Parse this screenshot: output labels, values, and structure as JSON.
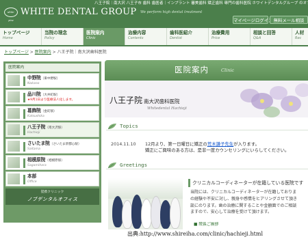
{
  "header": {
    "topline": "八王子院｜南大沢 八王子市 歯科 歯医者｜インプラント 審美歯科 矯正歯科 専門の歯科医院 ホワイトデンタルグループ のオフィシャ",
    "logo_badge": "white-pine",
    "logo_text": "WHITE DENTAL GROUP",
    "tagline": "We perform high dental treatment",
    "login_label": "マイページログイン",
    "mail_label": "無料メール相談"
  },
  "nav": [
    {
      "jp": "トップページ",
      "en": "Home",
      "active": false
    },
    {
      "jp": "当院の理念",
      "en": "Policy",
      "active": false
    },
    {
      "jp": "医院案内",
      "en": "Clinic",
      "active": true
    },
    {
      "jp": "治療内容",
      "en": "Contents",
      "active": false
    },
    {
      "jp": "歯科医紹介",
      "en": "Dentist",
      "active": false
    },
    {
      "jp": "治療費用",
      "en": "Price",
      "active": false
    },
    {
      "jp": "相談と回答",
      "en": "Q&A",
      "active": false
    },
    {
      "jp": "人材",
      "en": "Rec",
      "active": false
    }
  ],
  "breadcrumb": {
    "home": "トップページ",
    "sep": " > ",
    "clinic": "医院案内",
    "current": "八王子院｜南大沢歯科医院"
  },
  "sidebar": {
    "head": "医院案内",
    "clinics": [
      {
        "name": "中野院",
        "area": "（東中野駅）",
        "en": "Nakano",
        "note": ""
      },
      {
        "name": "品川院",
        "area": "（大井町駅）",
        "en": "",
        "note": "★9月1日より医療法人化します。"
      },
      {
        "name": "葛飾院",
        "area": "（金町駅）",
        "en": "Katsushika",
        "note": ""
      },
      {
        "name": "八王子院",
        "area": "（南大沢駅）",
        "en": "Hachioji",
        "note": ""
      },
      {
        "name": "さいたま院",
        "area": "（さいたま新都心駅）",
        "en": "Saitama",
        "note": ""
      },
      {
        "name": "相模原院",
        "area": "（相模原駅）",
        "en": "Sagamihara",
        "note": ""
      },
      {
        "name": "本部",
        "area": "",
        "en": "Office",
        "note": ""
      }
    ],
    "nobu_small": "提携クリニック",
    "nobu_big": "ノブデンタルオフィス"
  },
  "main": {
    "banner_title": "医院案内",
    "banner_sub": "Clinic",
    "hero_title": "八王子院",
    "hero_sub": "南大沢歯科医院",
    "hero_en": "Whitedental Hachioji",
    "topics_label": "Topics",
    "news": {
      "date": "2014.11.10",
      "text_before": "12月より、第一日曜日に矯正の",
      "link": "荒木謙子先生",
      "text_after": "が入ります。",
      "line2": "矯正にご興味のある方は、是非一度カウンセリングにいらしてください。"
    },
    "greetings_label": "Greetings",
    "greet_head": "クリニカルコーディネーターが在籍している医院です",
    "greet_lines": [
      "当院には、クリニカルコーディネーターが在籍しておりま",
      "の経験や不安に対し、親身や感情をヒアリングさせて頂き",
      "談にのります。歯の治療に関することや金額面でのご相談",
      "ますので、安心して治療を受けて頂けます。"
    ],
    "greet_more": "■ 院長ご挨拶"
  },
  "credit": "出典:http://www.shireiha.com/clinic/hachieji.html",
  "colors": {
    "brand_green": "#4b7f4b",
    "nav_active": "#6a9a66",
    "sidebar_bg": "#6e9a67",
    "link": "#1155cc",
    "notice_red": "#dd2222"
  },
  "icons": [
    "leaf-icon",
    "flower-decoration",
    "check-marker"
  ]
}
